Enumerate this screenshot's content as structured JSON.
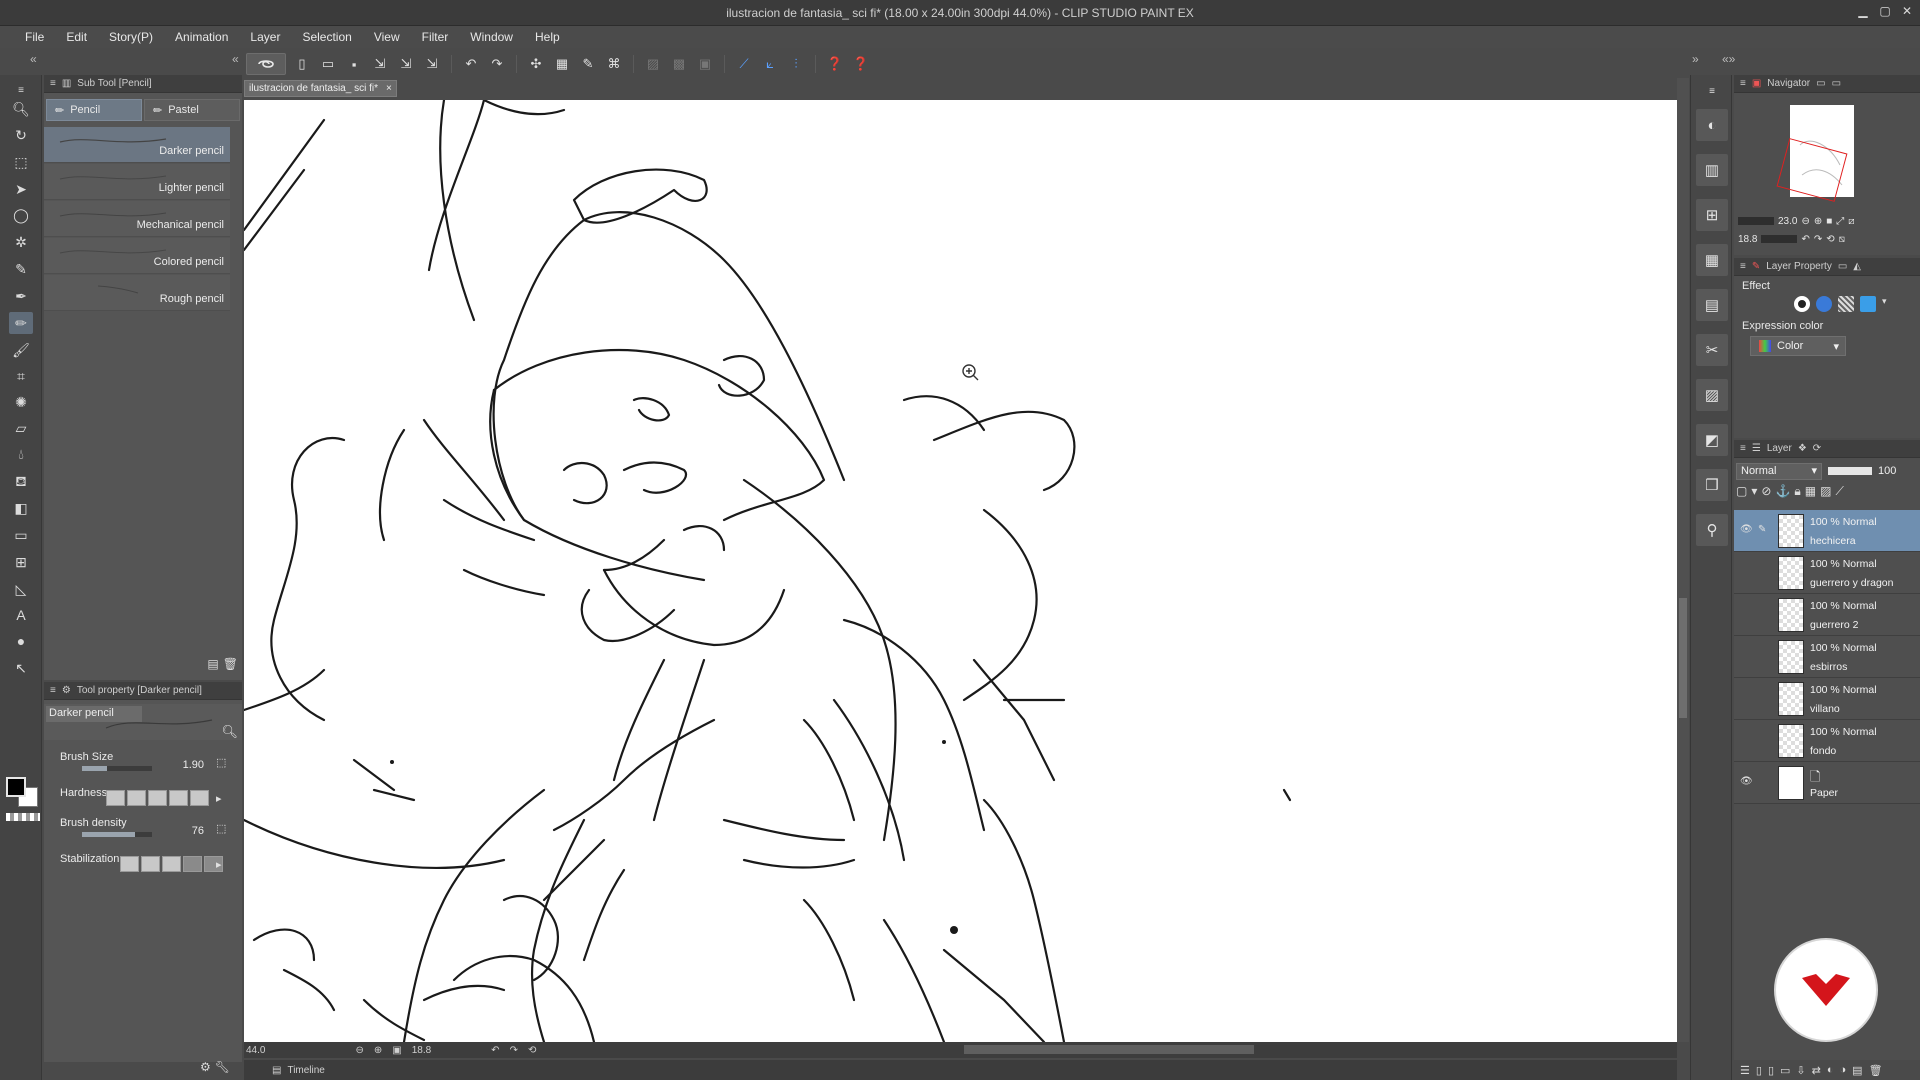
{
  "window": {
    "title": "ilustracion de fantasia_ sci fi* (18.00 x 24.00in 300dpi 44.0%)  - CLIP STUDIO PAINT EX"
  },
  "menu": [
    "File",
    "Edit",
    "Story(P)",
    "Animation",
    "Layer",
    "Selection",
    "View",
    "Filter",
    "Window",
    "Help"
  ],
  "document_tab": {
    "name": "ilustracion de fantasia_ sci fi*"
  },
  "subtool_panel": {
    "title": "Sub Tool [Pencil]",
    "tabs": [
      {
        "label": "Pencil",
        "active": true
      },
      {
        "label": "Pastel",
        "active": false
      }
    ],
    "brushes": [
      {
        "name": "Darker pencil",
        "selected": true
      },
      {
        "name": "Lighter pencil",
        "selected": false
      },
      {
        "name": "Mechanical pencil",
        "selected": false
      },
      {
        "name": "Colored pencil",
        "selected": false
      },
      {
        "name": "Rough pencil",
        "selected": false
      }
    ]
  },
  "tool_property": {
    "title": "Tool property [Darker pencil]",
    "preset_name": "Darker pencil",
    "brush_size": {
      "label": "Brush Size",
      "value": "1.90",
      "fraction": 0.35
    },
    "hardness": {
      "label": "Hardness",
      "level": 5
    },
    "brush_density": {
      "label": "Brush density",
      "value": "76",
      "fraction": 0.76
    },
    "stabilization": {
      "label": "Stabilization",
      "level": 3
    }
  },
  "status": {
    "zoom": "44.0",
    "angle": "18.8"
  },
  "timeline": {
    "label": "Timeline"
  },
  "navigator": {
    "title": "Navigator",
    "zoom": "23.0",
    "angle": "18.8"
  },
  "layer_property": {
    "title": "Layer Property",
    "effect_label": "Effect",
    "expression_color_label": "Expression color",
    "expression_color_value": "Color"
  },
  "layer_panel": {
    "title": "Layer",
    "blend_mode": "Normal",
    "opacity": "100",
    "layers": [
      {
        "mode": "100 % Normal",
        "name": "hechicera",
        "selected": true,
        "visible": true,
        "paper": false
      },
      {
        "mode": "100 % Normal",
        "name": "guerrero y dragon",
        "selected": false,
        "visible": false,
        "paper": false
      },
      {
        "mode": "100 % Normal",
        "name": "guerrero 2",
        "selected": false,
        "visible": false,
        "paper": false
      },
      {
        "mode": "100 % Normal",
        "name": "esbirros",
        "selected": false,
        "visible": false,
        "paper": false
      },
      {
        "mode": "100 % Normal",
        "name": "villano",
        "selected": false,
        "visible": false,
        "paper": false
      },
      {
        "mode": "100 % Normal",
        "name": "fondo",
        "selected": false,
        "visible": false,
        "paper": false
      },
      {
        "mode": "",
        "name": "Paper",
        "selected": false,
        "visible": true,
        "paper": true
      }
    ]
  },
  "colors": {
    "accent_selection": "#6f8fb0",
    "panel_bg": "#4e4e4e",
    "logo_red": "#d4151b"
  }
}
